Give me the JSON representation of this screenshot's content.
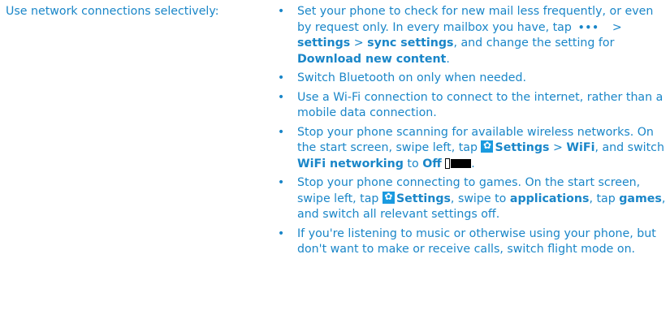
{
  "label": "Use network connections selectively:",
  "bullet": "•",
  "tips": {
    "t1": {
      "a": "Set your phone to check for new mail less frequently, or even by request only. In every mailbox you have, tap",
      "dots": "•••",
      "b": "> ",
      "settings": "settings",
      "c": " > ",
      "sync": "sync settings",
      "d": ", and change the setting for ",
      "download": "Download new content",
      "e": "."
    },
    "t2": {
      "text": "Switch Bluetooth on only when needed."
    },
    "t3": {
      "text": "Use a Wi-Fi connection to connect to the internet, rather than a mobile data connection."
    },
    "t4": {
      "a": "Stop your phone scanning for available wireless networks. On the start screen, swipe left, tap ",
      "settings": "Settings",
      "b": " > ",
      "wifi": "WiFi",
      "c": ", and switch ",
      "networking": "WiFi networking",
      "d": " to ",
      "off": "Off",
      "e": "."
    },
    "t5": {
      "a": "Stop your phone connecting to games. On the start screen, swipe left, tap ",
      "settings": "Settings",
      "b": ", swipe to ",
      "applications": "applications",
      "c": ", tap ",
      "games": "games",
      "d": ", and switch all relevant settings off."
    },
    "t6": {
      "text": "If you're listening to music or otherwise using your phone, but don't want to make or receive calls, switch flight mode on."
    }
  },
  "colors": {
    "text": "#1a86c8",
    "gear_icon": "#1a9be0",
    "toggle": "#000000"
  },
  "icons": {
    "more": "more-dots-icon",
    "settings": "settings-gear-icon",
    "toggle": "toggle-off-icon"
  }
}
